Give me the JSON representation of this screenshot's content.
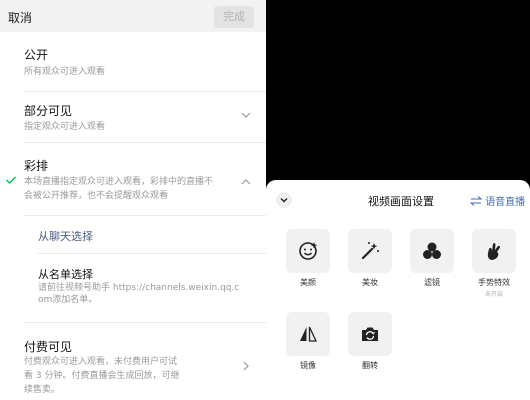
{
  "topbar": {
    "cancel_label": "取消",
    "done_label": "完成"
  },
  "options": [
    {
      "title": "公开",
      "desc": "所有观众可进入观看"
    },
    {
      "title": "部分可见",
      "desc": "指定观众可进入观看"
    },
    {
      "title": "彩排",
      "desc_line1": "本场直播指定观众可进入观看，彩排中的直播不",
      "desc_line2": "会被公开推荐，也不会提醒观众观看"
    },
    {
      "title": "付费可见",
      "desc_line1": "付费观众可进入观看，未付费用户可试",
      "desc_line2": "看 3 分钟。付费直播会生成回放，可继",
      "desc_line3": "续售卖。"
    }
  ],
  "rehearsal": {
    "chat_select_label": "从聊天选择",
    "list_select_title": "从名单选择",
    "list_select_desc_line1": "请前往视频号助手 https://channels.weixin.qq.c",
    "list_select_desc_line2": "om添加名单。"
  },
  "sheet": {
    "title": "视频画面设置",
    "voice_label": "语音直播",
    "tools": [
      {
        "label": "美颜",
        "icon": "beauty-face-icon"
      },
      {
        "label": "美妆",
        "icon": "makeup-wand-icon"
      },
      {
        "label": "滤镜",
        "icon": "filter-circles-icon"
      },
      {
        "label": "手势特效",
        "note": "未开启",
        "icon": "gesture-hand-icon"
      },
      {
        "label": "镜像",
        "icon": "mirror-icon"
      },
      {
        "label": "翻转",
        "icon": "flip-camera-icon"
      }
    ]
  },
  "colors": {
    "accent_link": "#4b5f80",
    "check_green": "#07c160",
    "voice_blue": "#3d6fb3"
  }
}
